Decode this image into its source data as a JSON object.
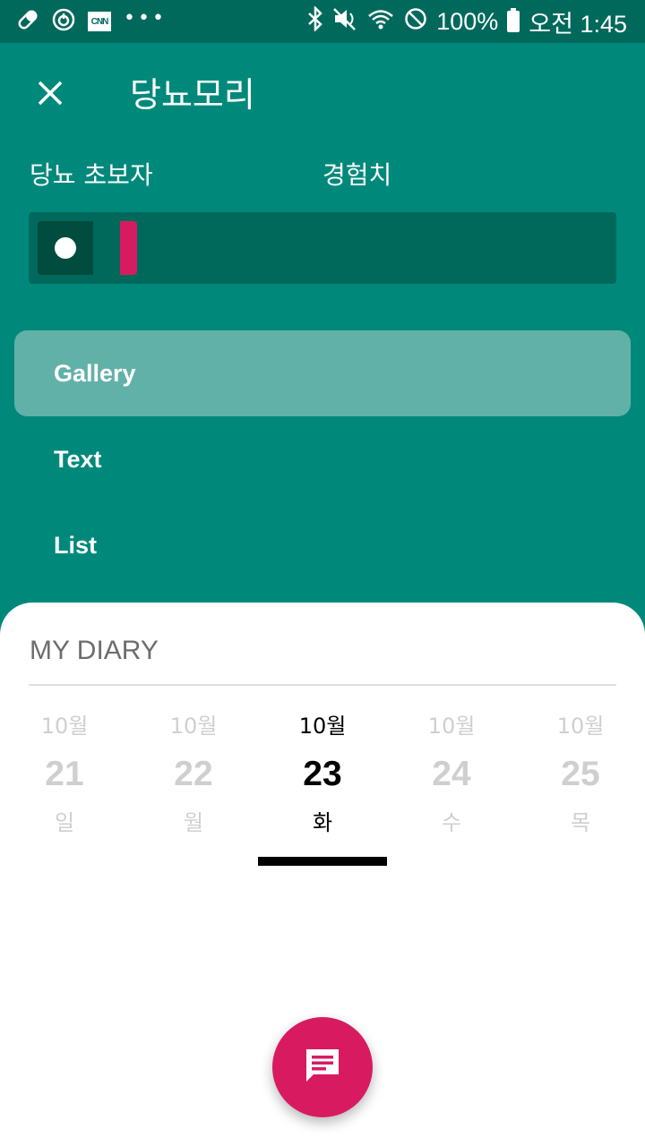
{
  "status_bar": {
    "left_icons": [
      "pill-icon",
      "power-app-icon",
      "cnn-icon",
      "more-notifications-icon"
    ],
    "cnn_text": "CNN",
    "more_text": "•••",
    "right_icons": [
      "bluetooth-icon",
      "mute-icon",
      "wifi-icon",
      "no-disturb-icon",
      "battery-icon"
    ],
    "battery_text": "100%",
    "time": "오전 1:45"
  },
  "header": {
    "close_icon": "close-icon",
    "title": "당뇨모리",
    "level_label": "당뇨 초보자",
    "exp_label": "경험치",
    "exp_progress": 0.07
  },
  "menu": {
    "items": [
      {
        "label": "Gallery",
        "active": true
      },
      {
        "label": "Text",
        "active": false
      },
      {
        "label": "List",
        "active": false
      }
    ]
  },
  "diary": {
    "title": "MY DIARY",
    "days": [
      {
        "month": "10월",
        "date": "21",
        "weekday": "일",
        "selected": false
      },
      {
        "month": "10월",
        "date": "22",
        "weekday": "월",
        "selected": false
      },
      {
        "month": "10월",
        "date": "23",
        "weekday": "화",
        "selected": true
      },
      {
        "month": "10월",
        "date": "24",
        "weekday": "수",
        "selected": false
      },
      {
        "month": "10월",
        "date": "25",
        "weekday": "목",
        "selected": false
      }
    ]
  },
  "fab": {
    "icon": "message-icon"
  },
  "colors": {
    "primary": "#00897b",
    "primary_dark": "#00695c",
    "accent": "#d81b60",
    "active_menu": "#62b1a9"
  }
}
